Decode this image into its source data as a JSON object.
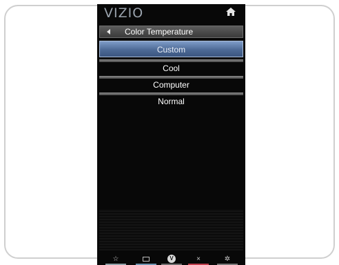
{
  "logo": {
    "text": "VIZIO"
  },
  "header": {
    "title": "Color Temperature"
  },
  "menu": {
    "items": [
      {
        "label": "Custom",
        "selected": true
      },
      {
        "label": "Cool",
        "selected": false
      },
      {
        "label": "Computer",
        "selected": false
      },
      {
        "label": "Normal",
        "selected": false
      }
    ]
  },
  "toolbar": {
    "buttons": [
      {
        "icon": "star-icon",
        "glyph": "☆"
      },
      {
        "icon": "card-icon",
        "glyph": ""
      },
      {
        "icon": "v-button-icon",
        "glyph": "V"
      },
      {
        "icon": "close-icon",
        "glyph": "×"
      },
      {
        "icon": "gear-icon",
        "glyph": "✲"
      }
    ]
  },
  "colors": {
    "background": "#080808",
    "selected": "#4d6a96",
    "header": "#4a4a4a",
    "exit": "#c23f4e"
  }
}
